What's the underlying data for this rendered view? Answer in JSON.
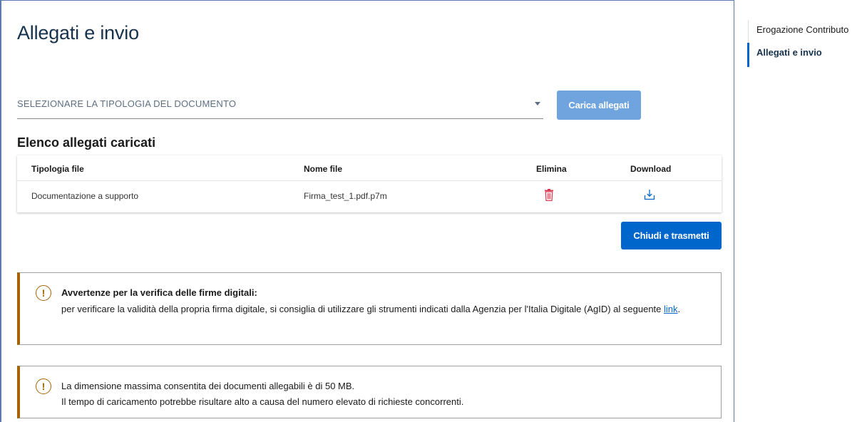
{
  "page": {
    "title": "Allegati e invio"
  },
  "upload": {
    "select_placeholder": "SELEZIONARE LA TIPOLOGIA DEL DOCUMENTO",
    "upload_button": "Carica allegati"
  },
  "attachments": {
    "section_title": "Elenco allegati caricati",
    "columns": [
      "Tipologia file",
      "Nome file",
      "Elimina",
      "Download"
    ],
    "rows": [
      {
        "tipologia": "Documentazione a supporto",
        "nome_file": "Firma_test_1.pdf.p7m",
        "delete_icon": "trash-icon",
        "download_icon": "download-icon"
      }
    ]
  },
  "actions": {
    "close_button": "Chiudi e trasmetti"
  },
  "alerts": {
    "signature": {
      "title": "Avvertenze per la verifica delle firme digitali:",
      "body_before_link": "per verificare la validità della propria firma digitale, si consiglia di utilizzare gli strumenti indicati dalla Agenzia per l'Italia Digitale (AgID) al seguente ",
      "link_text": "link",
      "body_after_link": "."
    },
    "size": {
      "line1": "La dimensione massima consentita dei documenti allegabili è di 50 MB.",
      "line2": "Il tempo di caricamento potrebbe risultare alto a causa del numero elevato di richieste concorrenti."
    },
    "icon_glyph": "!"
  },
  "sidenav": {
    "items": [
      {
        "label": "Erogazione Contributo",
        "active": false
      },
      {
        "label": "Allegati e invio",
        "active": true
      }
    ]
  },
  "colors": {
    "primary": "#0066cc",
    "primary_disabled": "#6fa4de",
    "warning": "#a56300",
    "danger": "#d9364f",
    "title": "#17324d"
  }
}
